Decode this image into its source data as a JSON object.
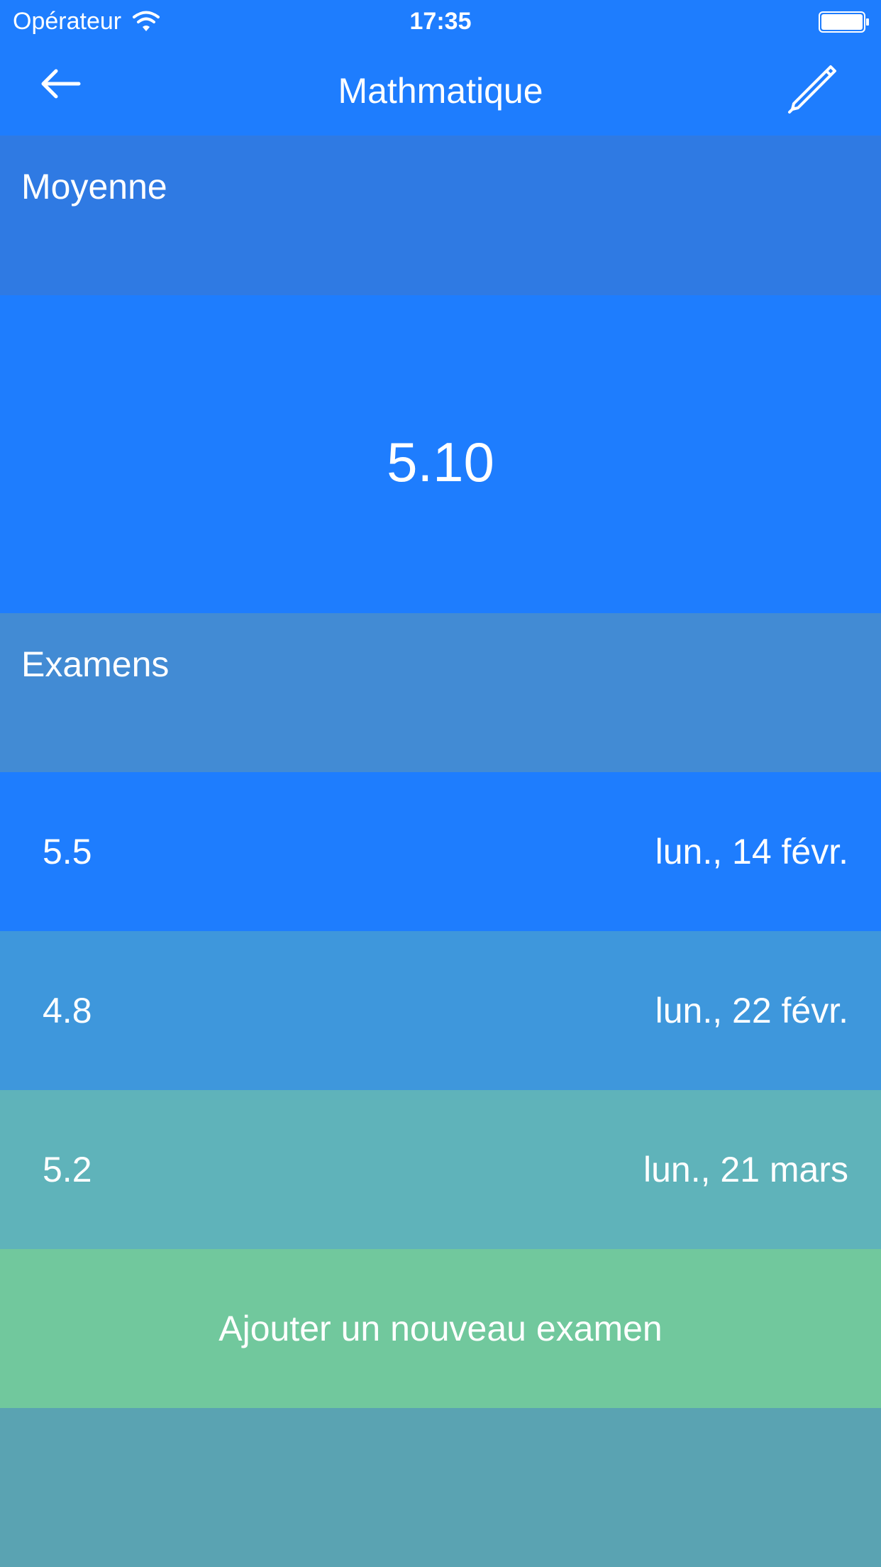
{
  "status_bar": {
    "carrier": "Opérateur",
    "time": "17:35",
    "wifi_icon": "wifi-icon",
    "battery_icon": "battery-icon"
  },
  "nav": {
    "back_icon": "arrow-left-icon",
    "title": "Mathmatique",
    "edit_icon": "pencil-icon"
  },
  "average": {
    "header_label": "Moyenne",
    "value": "5.10"
  },
  "exams": {
    "header_label": "Examens",
    "rows": [
      {
        "grade": "5.5",
        "date": "lun., 14 févr.",
        "color": "#1e7dfe"
      },
      {
        "grade": "4.8",
        "date": "lun., 22 févr.",
        "color": "#3e97dc"
      },
      {
        "grade": "5.2",
        "date": "lun., 21 mars",
        "color": "#5fb3ba"
      }
    ]
  },
  "add_button": {
    "label": "Ajouter un nouveau examen"
  },
  "colors": {
    "primary": "#1e7dfe",
    "header": "#2f7ae3",
    "exams_header": "#428bd4",
    "add_button": "#71c89d",
    "background": "#5aa3b2"
  }
}
